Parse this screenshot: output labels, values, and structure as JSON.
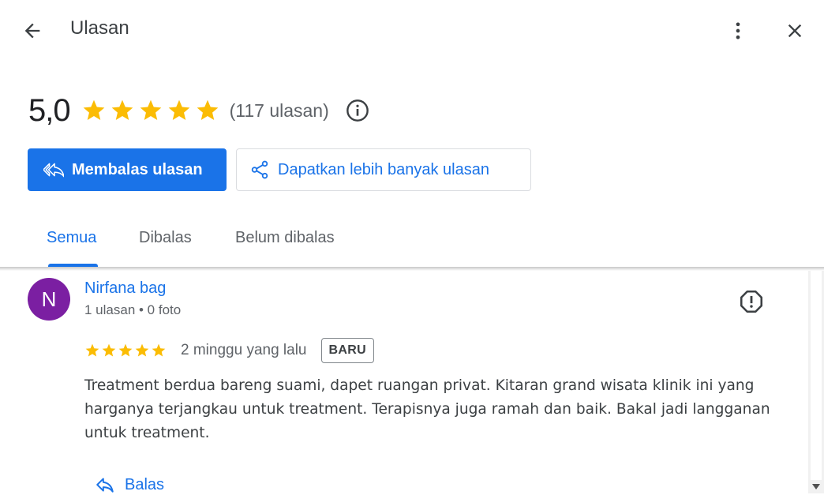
{
  "header": {
    "title": "Ulasan"
  },
  "summary": {
    "rating": "5,0",
    "stars": 5,
    "count_text": "(117 ulasan)"
  },
  "actions": {
    "reply_reviews_label": "Membalas ulasan",
    "get_more_reviews_label": "Dapatkan lebih banyak ulasan"
  },
  "tabs": [
    {
      "label": "Semua",
      "active": true
    },
    {
      "label": "Dibalas",
      "active": false
    },
    {
      "label": "Belum dibalas",
      "active": false
    }
  ],
  "review": {
    "avatar_letter": "N",
    "author": "Nirfana bag",
    "meta": "1 ulasan • 0 foto",
    "stars": 5,
    "date": "2 minggu yang lalu",
    "badge": "BARU",
    "text": "Treatment berdua bareng suami, dapet ruangan privat. Kitaran grand wisata klinik ini yang harganya terjangkau untuk treatment. Terapisnya juga ramah dan baik. Bakal jadi langganan untuk treatment.",
    "reply_label": "Balas"
  },
  "colors": {
    "accent": "#1a73e8",
    "star": "#fbbc04",
    "avatar": "#7b1fa2"
  }
}
